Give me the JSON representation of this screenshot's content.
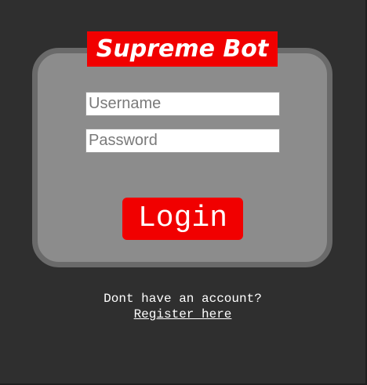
{
  "logo": {
    "text": "Supreme Bot"
  },
  "form": {
    "username_placeholder": "Username",
    "password_placeholder": "Password",
    "login_label": "Login"
  },
  "footer": {
    "prompt": "Dont have an account?",
    "register_link": "Register here"
  },
  "colors": {
    "background": "#2f2f2f",
    "card": "#8c8c8c",
    "card_border": "#6a6a6a",
    "accent": "#f10000"
  }
}
